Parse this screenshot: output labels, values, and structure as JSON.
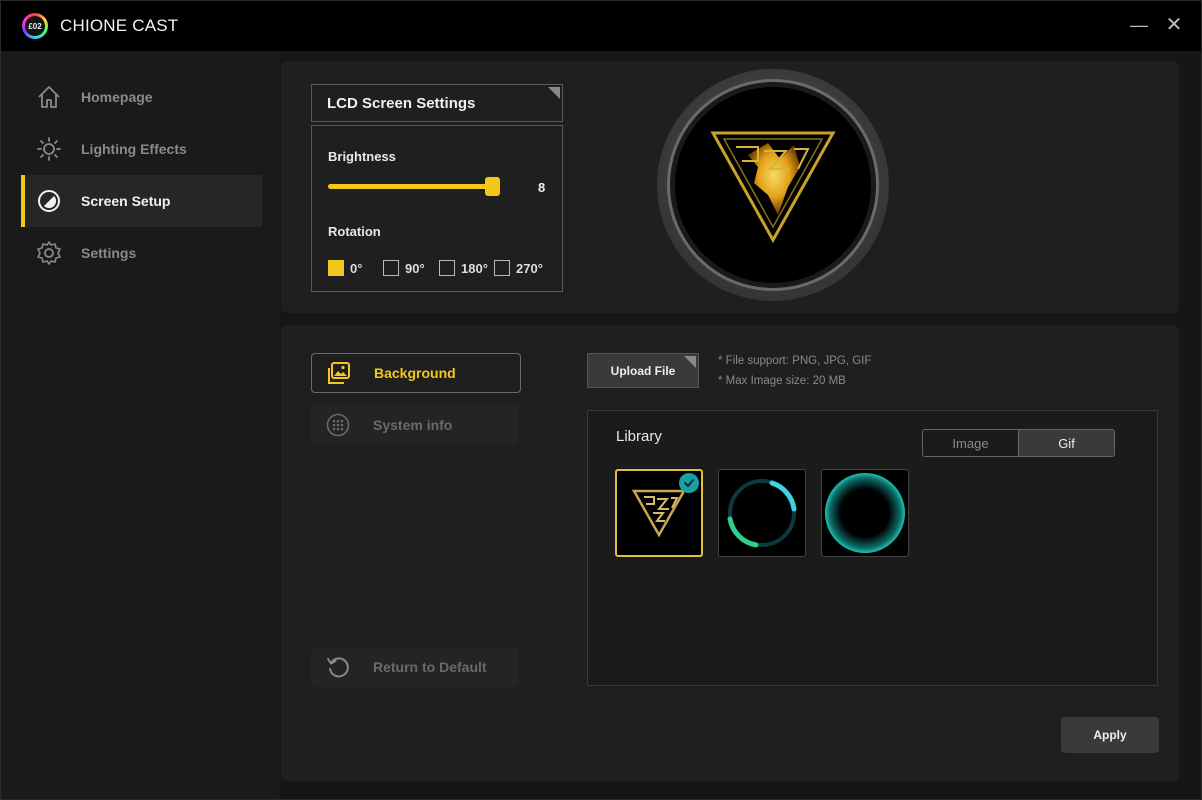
{
  "window": {
    "title": "CHIONE CAST",
    "logo_text": "£02",
    "minimize_glyph": "—",
    "close_glyph": "✕"
  },
  "sidebar": {
    "items": [
      {
        "label": "Homepage",
        "icon": "home-icon",
        "active": false
      },
      {
        "label": "Lighting Effects",
        "icon": "sun-icon",
        "active": false
      },
      {
        "label": "Screen Setup",
        "icon": "screen-icon",
        "active": true
      },
      {
        "label": "Settings",
        "icon": "gear-icon",
        "active": false
      }
    ]
  },
  "lcd": {
    "title": "LCD Screen Settings",
    "brightness_label": "Brightness",
    "brightness_value": "8",
    "brightness_fraction": 0.98,
    "rotation_label": "Rotation",
    "rotations": [
      {
        "label": "0°",
        "checked": true
      },
      {
        "label": "90°",
        "checked": false
      },
      {
        "label": "180°",
        "checked": false
      },
      {
        "label": "270°",
        "checked": false
      }
    ]
  },
  "media": {
    "background_label": "Background",
    "system_info_label": "System info",
    "return_label": "Return to Default",
    "upload_label": "Upload File",
    "note_formats": "* File support: PNG, JPG, GIF",
    "note_size": "* Max Image size: 20 MB",
    "library_title": "Library",
    "tabs": {
      "image": "Image",
      "gif": "Gif",
      "active": "Gif"
    },
    "thumbnails": [
      "logo-triangle",
      "cyan-arc-ring",
      "teal-glow-ring"
    ],
    "selected_index": 0
  },
  "apply_label": "Apply",
  "colors": {
    "accent": "#f2c81b",
    "check": "#17a0a6",
    "ring": "#1fd0c8"
  }
}
